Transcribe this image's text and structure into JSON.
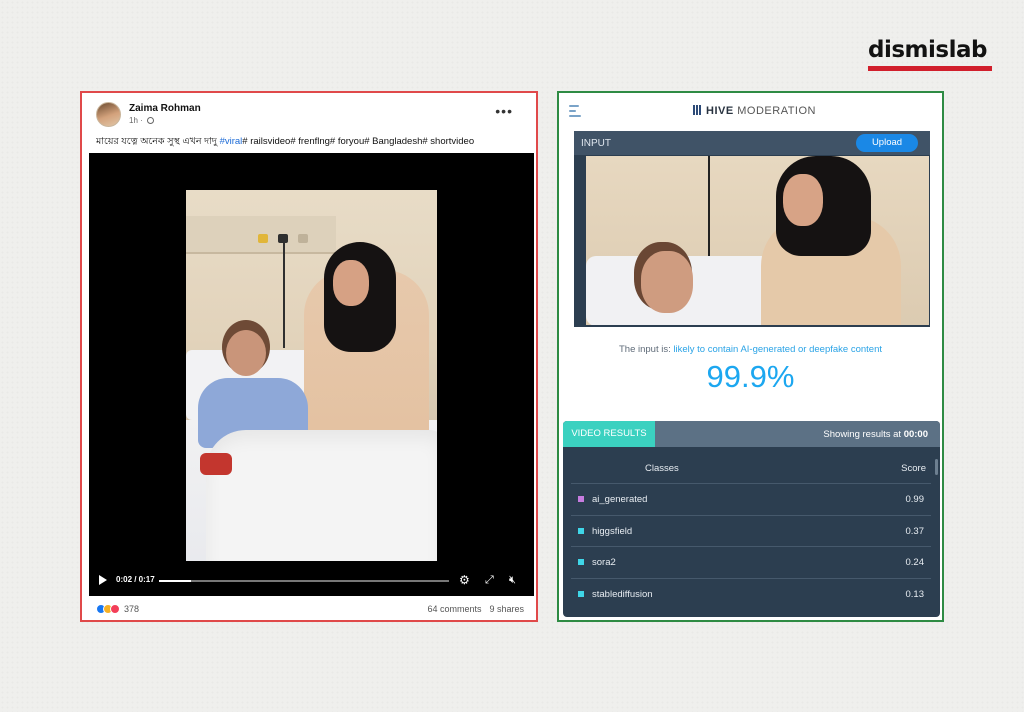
{
  "brand_logo": {
    "text": "dismislab",
    "underline_color": "#d11f2c"
  },
  "facebook_post": {
    "author": "Zaima Rohman",
    "time": "1h",
    "more": "•••",
    "caption_text": "মায়ের যত্নে অনেক  সুস্থ এখন দাদু ",
    "caption_tag": "#viral",
    "caption_rest": "# railsvideo# frenflng# foryou# Bangladesh# shortvideo",
    "video_time": "0:02 / 0:17",
    "video_progress": 0.11,
    "reaction_count": "378",
    "comments": "64 comments",
    "shares": "9 shares"
  },
  "hive": {
    "title_brand": "HIVE",
    "title_rest": "MODERATION",
    "input_label": "INPUT",
    "upload_label": "Upload",
    "verdict_prefix": "The input is:",
    "verdict_value": "likely to contain AI-generated or deepfake content",
    "percent": "99.9%",
    "results_tab": "VIDEO RESULTS",
    "showing_prefix": "Showing results at",
    "showing_time": "00:00",
    "col_classes": "Classes",
    "col_score": "Score",
    "rows": [
      {
        "name": "ai_generated",
        "score": "0.99",
        "color": "#c77ce0"
      },
      {
        "name": "higgsfield",
        "score": "0.37",
        "color": "#3fd6e8"
      },
      {
        "name": "sora2",
        "score": "0.24",
        "color": "#3fd6e8"
      },
      {
        "name": "stablediffusion",
        "score": "0.13",
        "color": "#3fd6e8"
      }
    ]
  },
  "colors": {
    "left_border": "#e0494a",
    "right_border": "#2e8b44",
    "accent_blue": "#1ca7f0",
    "results_bg": "#2c3e50"
  }
}
